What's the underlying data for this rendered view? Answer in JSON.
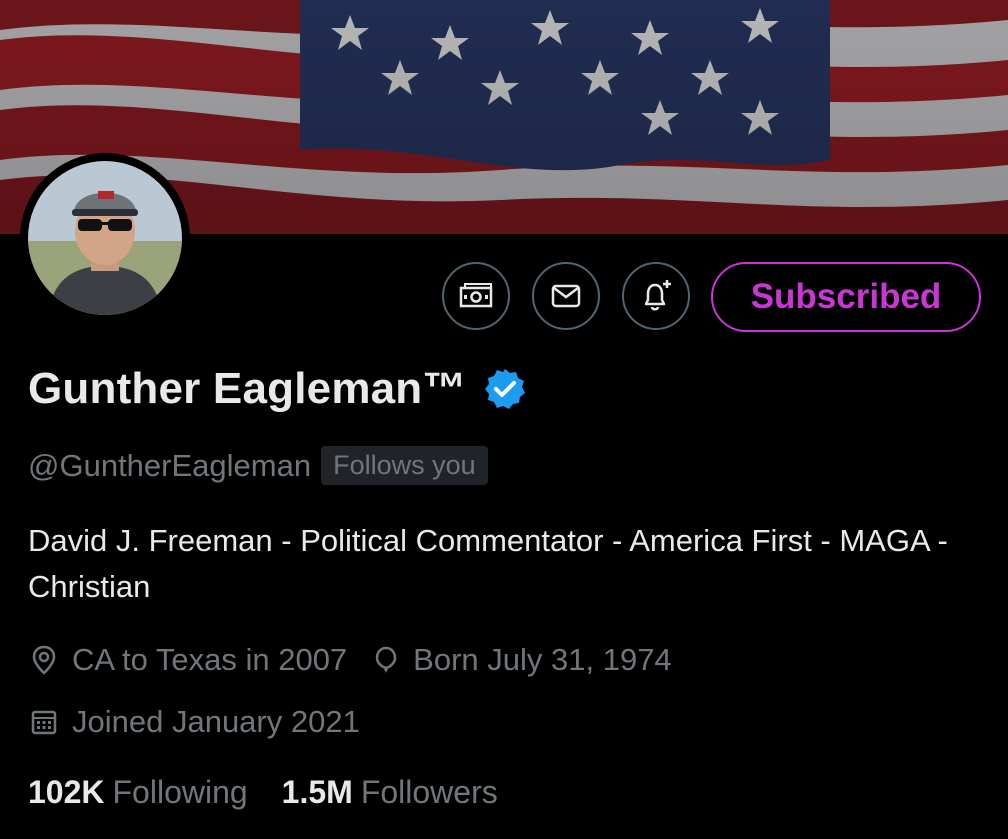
{
  "profile": {
    "name": "Gunther Eagleman™",
    "handle": "@GuntherEagleman",
    "follows_you": "Follows you",
    "bio": "David J. Freeman - Political Commentator - America First - MAGA - Christian",
    "location": "CA to Texas in 2007",
    "birthday": "Born July 31, 1974",
    "joined": "Joined January 2021",
    "verified": true
  },
  "actions": {
    "subscribe_label": "Subscribed"
  },
  "stats": {
    "following_count": "102K",
    "following_label": "Following",
    "followers_count": "1.5M",
    "followers_label": "Followers"
  },
  "icons": {
    "tip": "money-icon",
    "message": "mail-icon",
    "notify": "bell-plus-icon",
    "location": "location-pin-icon",
    "birthday": "balloon-icon",
    "joined": "calendar-icon",
    "verified": "verified-badge-icon"
  },
  "colors": {
    "background": "#000000",
    "subscribe_accent": "#c936d3",
    "verified_blue": "#1d9bf0",
    "muted_text": "#71767b",
    "primary_text": "#e7e9ea"
  }
}
